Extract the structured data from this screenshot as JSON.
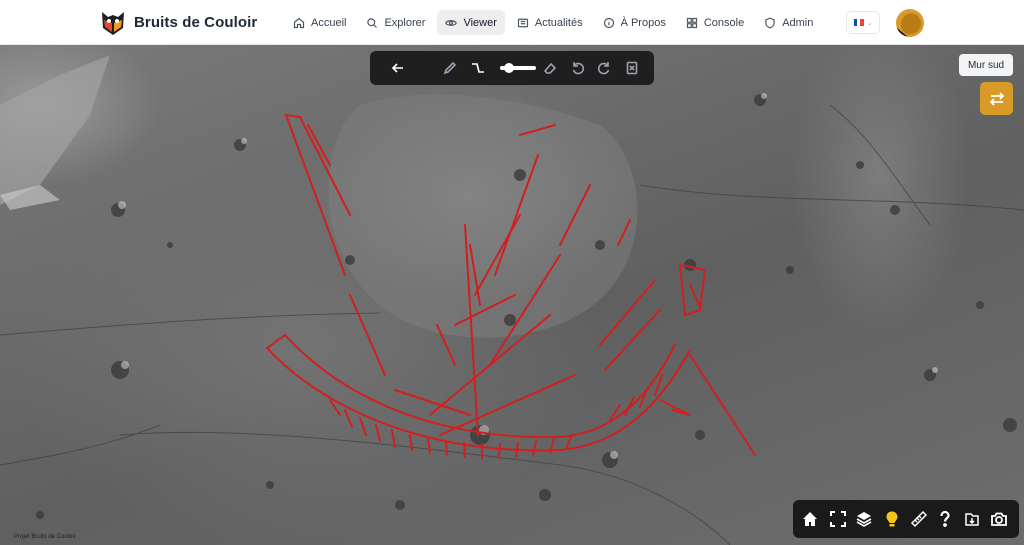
{
  "app": {
    "brand_name": "Bruits de Couloir",
    "logo_icon": "owl-logo-icon"
  },
  "nav": {
    "items": [
      {
        "label": "Accueil",
        "icon": "home-icon",
        "active": false
      },
      {
        "label": "Explorer",
        "icon": "search-icon",
        "active": false
      },
      {
        "label": "Viewer",
        "icon": "eye-icon",
        "active": true
      },
      {
        "label": "Actualités",
        "icon": "newspaper-icon",
        "active": false
      },
      {
        "label": "À Propos",
        "icon": "info-icon",
        "active": false
      },
      {
        "label": "Console",
        "icon": "grid-icon",
        "active": false
      },
      {
        "label": "Admin",
        "icon": "shield-icon",
        "active": false
      }
    ]
  },
  "language": {
    "selected": "FR",
    "flag_colors": [
      "#0055A4",
      "#FFFFFF",
      "#EF4135"
    ]
  },
  "viewer": {
    "tooltip": "Mur sud",
    "credit": "Projet Bruits de Couloir",
    "toolbar": {
      "back_icon": "arrow-left-icon",
      "tools": [
        "pencil-icon",
        "polyline-icon",
        "brush-size-slider",
        "eraser-icon",
        "undo-icon",
        "redo-icon",
        "clear-icon"
      ],
      "brush_size": 0.25
    },
    "swap_icon": "swap-arrows-icon",
    "bottom_tools": [
      "home-icon",
      "fullscreen-icon",
      "layers-icon",
      "lightbulb-icon",
      "ruler-icon",
      "help-icon",
      "export-icon",
      "camera-icon"
    ]
  },
  "colors": {
    "accent": "#D89B28",
    "annotation": "#D11F1F",
    "toolbar_bg": "#1F1F1F",
    "lightbulb": "#F5C518"
  }
}
